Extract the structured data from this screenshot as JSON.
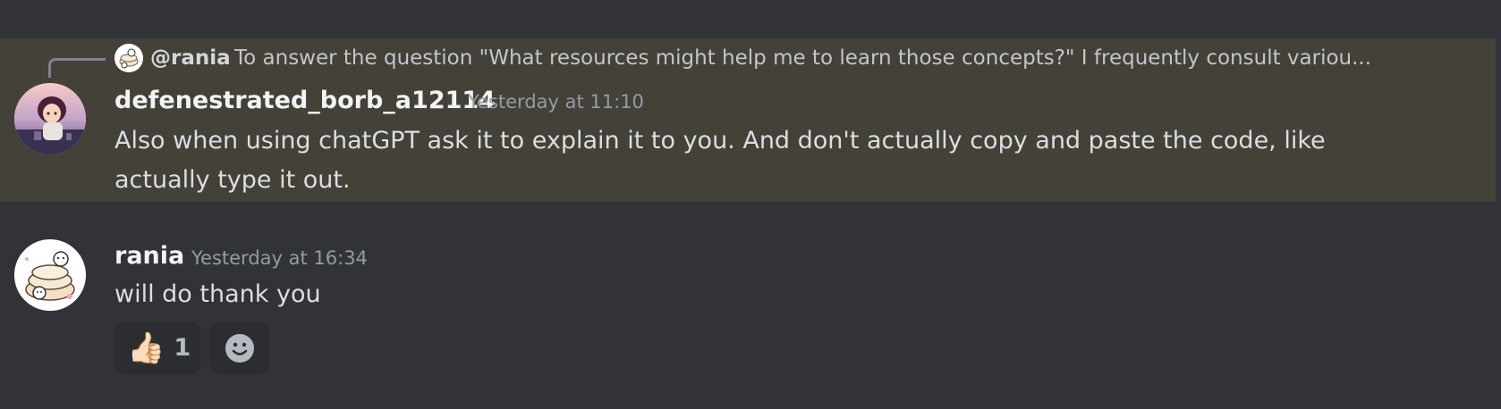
{
  "messages": [
    {
      "reply": {
        "author": "@rania",
        "text": "To answer the question \"What resources might help me to learn those concepts?\"   I frequently consult variou..."
      },
      "author": "defenestrated_borb_a12114",
      "timestamp": "Yesterday at 11:10",
      "content": "Also when using chatGPT ask it to explain it to you. And don't actually copy and paste the code, like actually type it out.",
      "highlighted": true
    },
    {
      "author": "rania",
      "timestamp": "Yesterday at 16:34",
      "content": "will do thank you",
      "reactions": [
        {
          "emoji": "👍🏻",
          "count": "1"
        }
      ]
    }
  ],
  "colors": {
    "background": "#313338",
    "highlight": "#444139",
    "reaction_bg": "#2b2d31",
    "author": "#f2f3f5",
    "timestamp": "#949ba4",
    "text": "#dbdee1"
  },
  "icons": {
    "add_reaction": "smile-face-icon",
    "reply": "reply-spine-icon"
  }
}
